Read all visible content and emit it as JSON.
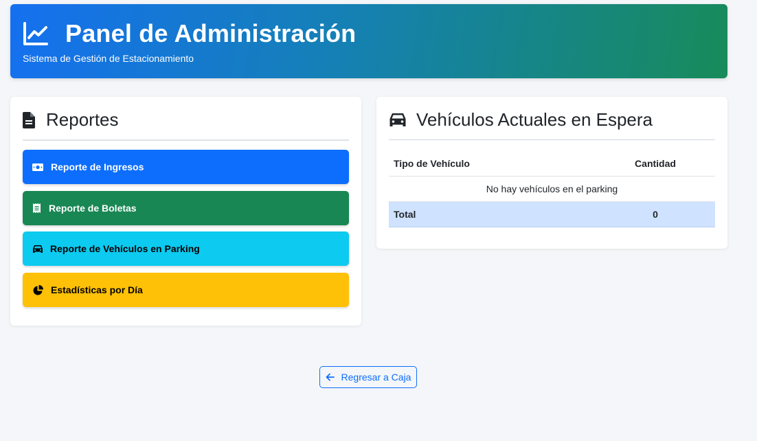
{
  "header": {
    "title": "Panel de Administración",
    "subtitle": "Sistema de Gestión de Estacionamiento",
    "icon": "chart-line-icon"
  },
  "reports": {
    "title": "Reportes",
    "icon": "file-icon",
    "buttons": [
      {
        "label": "Reporte de Ingresos",
        "icon": "money-bill-icon",
        "color": "#0d6efd"
      },
      {
        "label": "Reporte de Boletas",
        "icon": "receipt-icon",
        "color": "#198754"
      },
      {
        "label": "Reporte de Vehículos en Parking",
        "icon": "car-icon",
        "color": "#0dcaf0"
      },
      {
        "label": "Estadísticas por Día",
        "icon": "chart-pie-icon",
        "color": "#ffc107"
      }
    ]
  },
  "vehicles": {
    "title": "Vehículos Actuales en Espera",
    "icon": "car-icon",
    "columns": [
      "Tipo de Vehículo",
      "Cantidad"
    ],
    "empty_message": "No hay vehículos en el parking",
    "total_label": "Total",
    "total_value": "0"
  },
  "back_button": {
    "label": "Regresar a Caja",
    "icon": "arrow-left-icon"
  }
}
